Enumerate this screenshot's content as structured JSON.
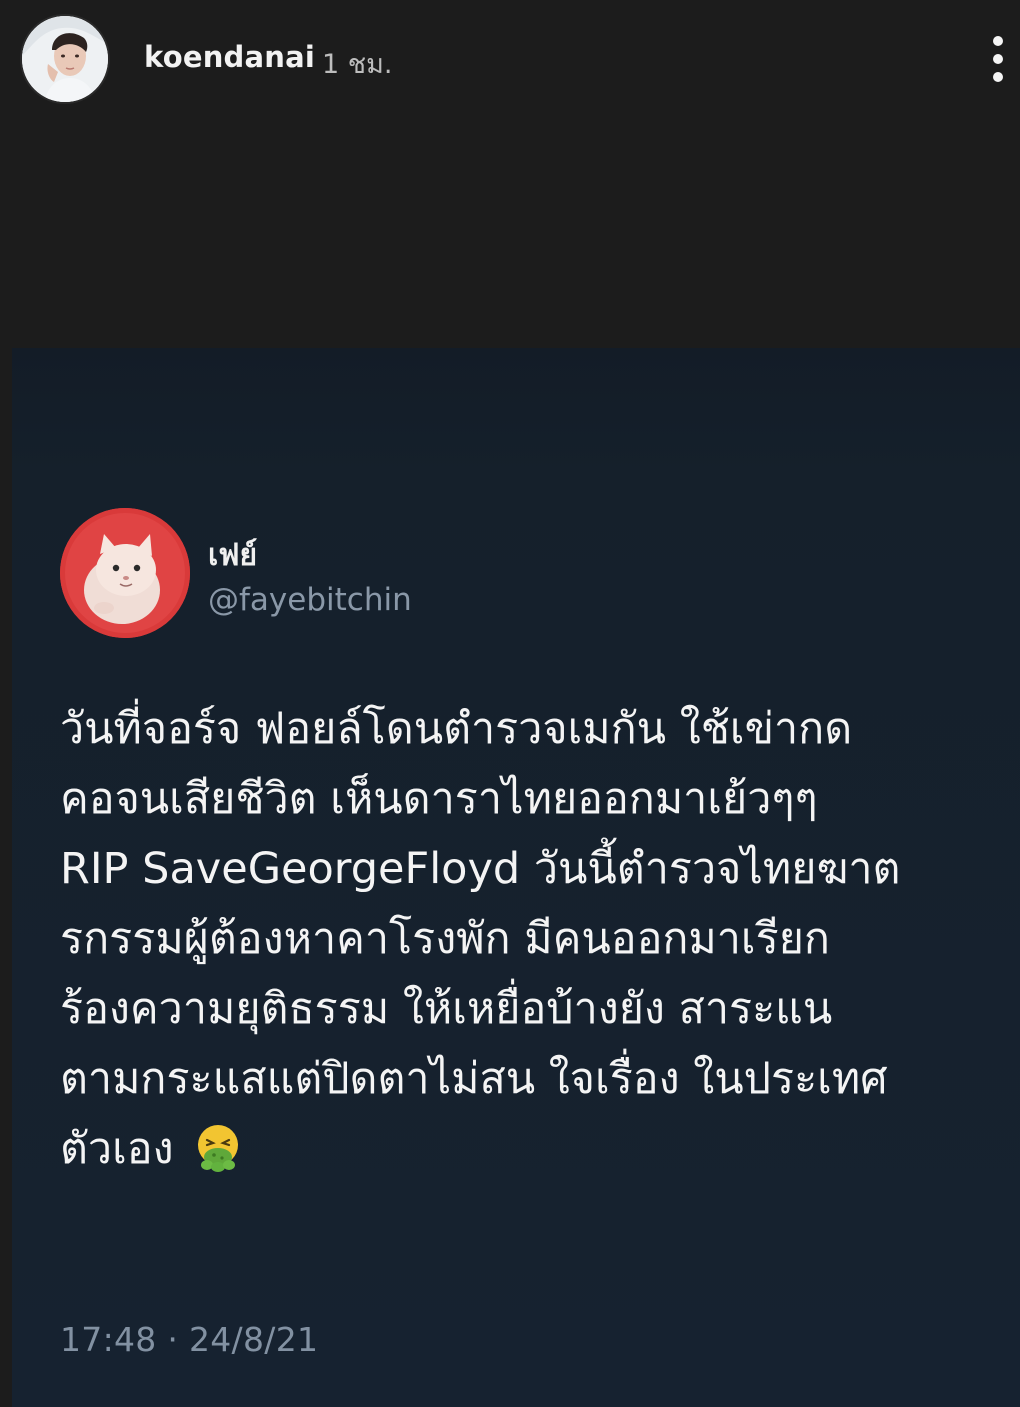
{
  "story": {
    "username": "koendanai",
    "time": "1 ชม.",
    "more_icon": "more-vertical-icon"
  },
  "tweet": {
    "display_name": "เฟย์",
    "handle": "@fayebitchin",
    "body_lines": [
      "วันที่จอร์จ ฟอยล์โดนตำรวจเมกัน ใช้เข่ากด",
      "คอจนเสียชีวิต เห็นดาราไทยออกมาเย้วๆๆ",
      "RIP SaveGeorgeFloyd วันนี้ตำรวจไทยฆาต",
      "รกรรมผู้ต้องหาคาโรงพัก มีคนออกมาเรียก",
      "ร้องความยุติธรรม ให้เหยื่อบ้างยัง สาระแน",
      "ตามกระแสแต่ปิดตาไม่สน ใจเรื่อง ในประเทศ",
      "ตัวเอง"
    ],
    "emoji": "nauseated-face-icon",
    "timestamp": "17:48 · 24/8/21"
  },
  "colors": {
    "story_bg": "#1c1c1c",
    "tweet_bg": "#15202b",
    "handle": "#8a98a8"
  }
}
